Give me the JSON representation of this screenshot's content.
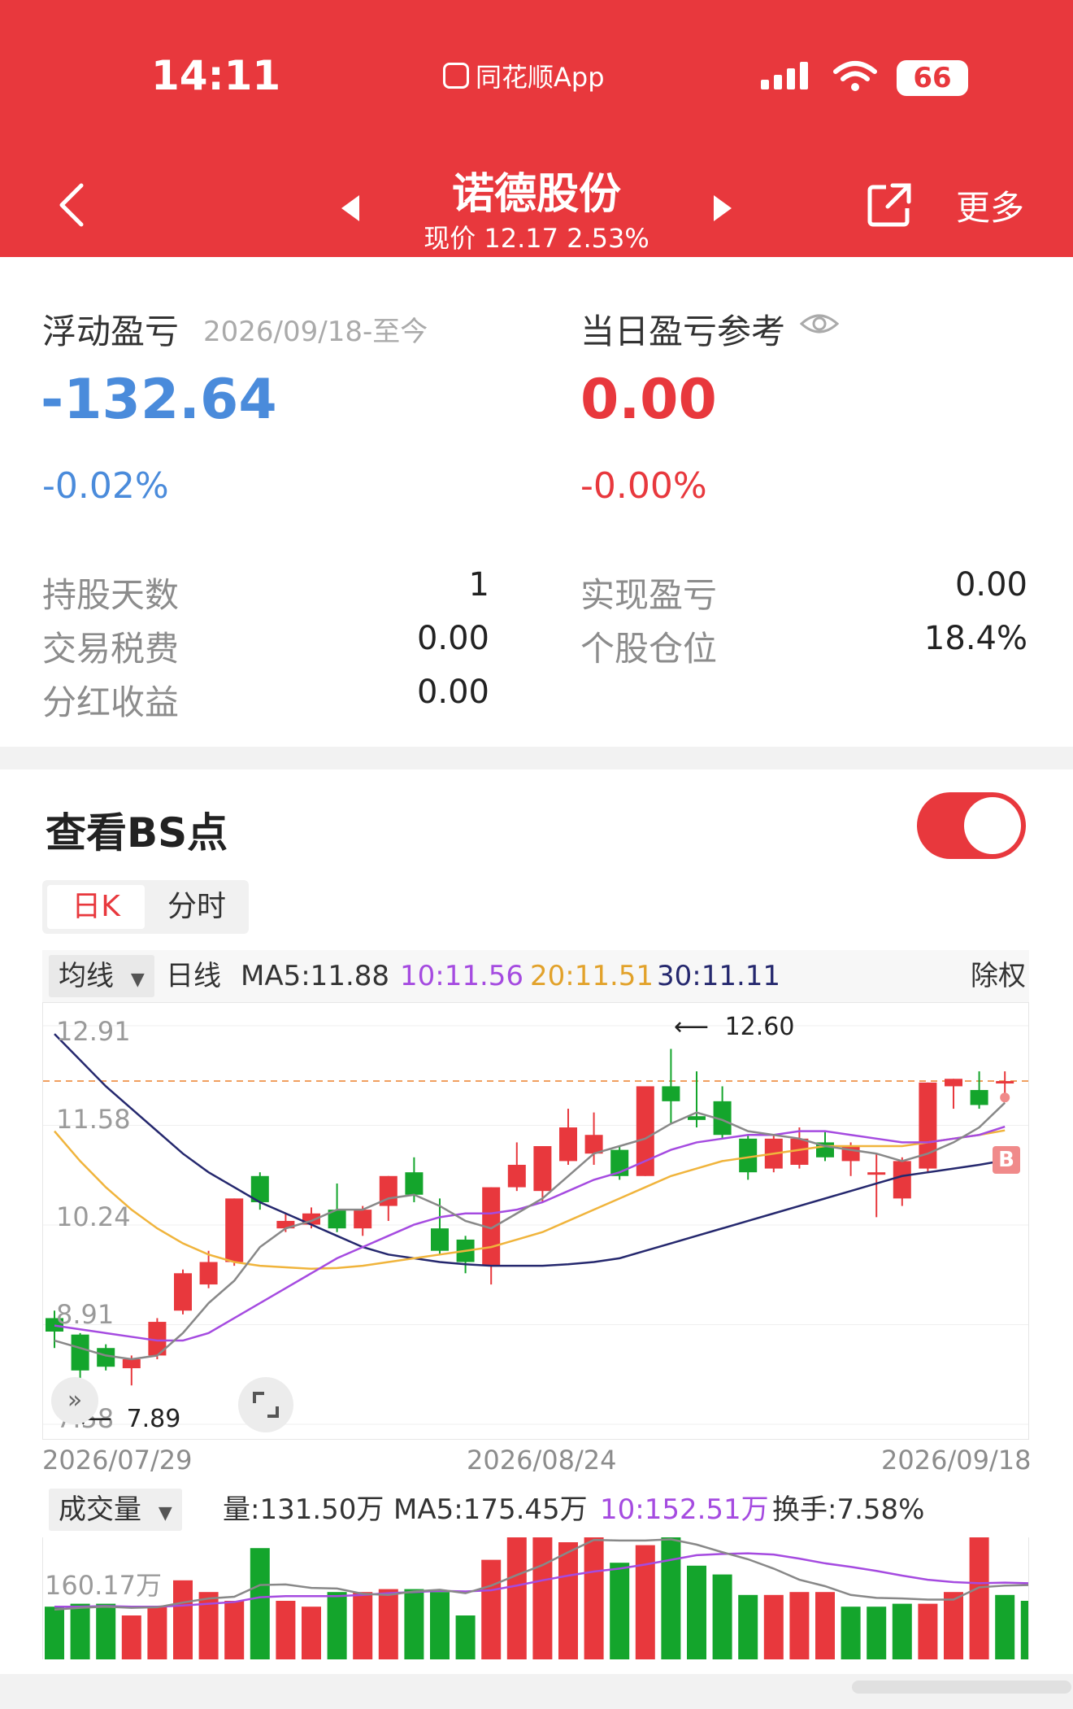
{
  "status_bar": {
    "time": "14:11",
    "app_label": "同花顺App",
    "battery": "66"
  },
  "nav": {
    "title": "诺德股份",
    "subtitle": "现价 12.17 2.53%",
    "more_label": "更多"
  },
  "pnl": {
    "float_label": "浮动盈亏",
    "float_range": "2026/09/18-至今",
    "float_value": "-132.64",
    "float_pct": "-0.02%",
    "day_label": "当日盈亏参考",
    "day_value": "0.00",
    "day_pct": "-0.00%"
  },
  "stats": [
    {
      "label": "持股天数",
      "value": "1"
    },
    {
      "label": "交易税费",
      "value": "0.00"
    },
    {
      "label": "分红收益",
      "value": "0.00"
    },
    {
      "label": "实现盈亏",
      "value": "0.00"
    },
    {
      "label": "个股仓位",
      "value": "18.4%"
    }
  ],
  "bs": {
    "title": "查看BS点",
    "toggle_on": true
  },
  "tabs": {
    "day_k": "日K",
    "intraday": "分时"
  },
  "kline": {
    "ma_dropdown": "均线",
    "period": "日线",
    "ma5": "MA5:11.88",
    "ma10": "10:11.56",
    "ma20": "20:11.51",
    "ma30": "30:11.11",
    "adjust": "除权",
    "y_labels": [
      "12.91",
      "11.58",
      "10.24",
      "8.91",
      "7.58"
    ],
    "x_labels": [
      "2026/07/29",
      "2026/08/24",
      "2026/09/18"
    ],
    "high_note": "12.60",
    "low_note": "7.89",
    "buy_marker": "B",
    "colors": {
      "up": "#e8383d",
      "down": "#14a52c",
      "ma5": "#888888",
      "ma10": "#a54be0",
      "ma20": "#f0b43c",
      "ma30": "#25286e"
    }
  },
  "volume": {
    "dropdown": "成交量",
    "vol": "量:131.50万",
    "ma5": "MA5:175.45万",
    "ma10": "10:152.51万",
    "turnover": "换手:7.58%",
    "y_label": "160.17万"
  },
  "chart_data": {
    "type": "candlestick",
    "x_start": "2026/07/29",
    "x_mid": "2026/08/24",
    "x_end": "2026/09/18",
    "ylim": [
      7.58,
      12.91
    ],
    "candles": [
      {
        "o": 9.0,
        "c": 8.82,
        "h": 9.1,
        "l": 8.6
      },
      {
        "o": 8.78,
        "c": 8.3,
        "h": 8.8,
        "l": 7.95
      },
      {
        "o": 8.6,
        "c": 8.35,
        "h": 8.65,
        "l": 8.3
      },
      {
        "o": 8.33,
        "c": 8.45,
        "h": 8.5,
        "l": 8.1
      },
      {
        "o": 8.5,
        "c": 8.95,
        "h": 9.0,
        "l": 8.45
      },
      {
        "o": 9.1,
        "c": 9.6,
        "h": 9.65,
        "l": 9.05
      },
      {
        "o": 9.45,
        "c": 9.75,
        "h": 9.9,
        "l": 9.4
      },
      {
        "o": 9.75,
        "c": 10.6,
        "h": 10.6,
        "l": 9.7
      },
      {
        "o": 10.9,
        "c": 10.55,
        "h": 10.95,
        "l": 10.45
      },
      {
        "o": 10.2,
        "c": 10.3,
        "h": 10.4,
        "l": 10.15
      },
      {
        "o": 10.25,
        "c": 10.4,
        "h": 10.48,
        "l": 10.2
      },
      {
        "o": 10.45,
        "c": 10.2,
        "h": 10.8,
        "l": 10.15
      },
      {
        "o": 10.2,
        "c": 10.45,
        "h": 10.5,
        "l": 10.1
      },
      {
        "o": 10.5,
        "c": 10.9,
        "h": 10.9,
        "l": 10.3
      },
      {
        "o": 10.95,
        "c": 10.65,
        "h": 11.15,
        "l": 10.55
      },
      {
        "o": 10.2,
        "c": 9.9,
        "h": 10.6,
        "l": 9.85
      },
      {
        "o": 10.05,
        "c": 9.75,
        "h": 10.1,
        "l": 9.6
      },
      {
        "o": 9.7,
        "c": 10.75,
        "h": 10.75,
        "l": 9.45
      },
      {
        "o": 10.75,
        "c": 11.05,
        "h": 11.35,
        "l": 10.7
      },
      {
        "o": 10.7,
        "c": 11.3,
        "h": 11.3,
        "l": 10.55
      },
      {
        "o": 11.1,
        "c": 11.55,
        "h": 11.8,
        "l": 11.05
      },
      {
        "o": 11.2,
        "c": 11.45,
        "h": 11.75,
        "l": 11.05
      },
      {
        "o": 11.25,
        "c": 10.9,
        "h": 11.3,
        "l": 10.85
      },
      {
        "o": 10.9,
        "c": 12.1,
        "h": 12.1,
        "l": 10.9
      },
      {
        "o": 12.1,
        "c": 11.9,
        "h": 12.6,
        "l": 11.6
      },
      {
        "o": 11.7,
        "c": 11.65,
        "h": 12.3,
        "l": 11.55
      },
      {
        "o": 11.9,
        "c": 11.45,
        "h": 12.1,
        "l": 11.4
      },
      {
        "o": 11.4,
        "c": 10.95,
        "h": 11.45,
        "l": 10.85
      },
      {
        "o": 11.0,
        "c": 11.4,
        "h": 11.45,
        "l": 10.95
      },
      {
        "o": 11.05,
        "c": 11.4,
        "h": 11.55,
        "l": 11.0
      },
      {
        "o": 11.35,
        "c": 11.15,
        "h": 11.5,
        "l": 11.1
      },
      {
        "o": 11.1,
        "c": 11.3,
        "h": 11.35,
        "l": 10.9
      },
      {
        "o": 10.95,
        "c": 10.95,
        "h": 11.2,
        "l": 10.35
      },
      {
        "o": 10.6,
        "c": 11.1,
        "h": 11.15,
        "l": 10.5
      },
      {
        "o": 11.0,
        "c": 12.15,
        "h": 12.15,
        "l": 10.95
      },
      {
        "o": 12.1,
        "c": 12.2,
        "h": 12.2,
        "l": 11.8
      },
      {
        "o": 12.05,
        "c": 11.85,
        "h": 12.3,
        "l": 11.8
      },
      {
        "o": 12.15,
        "c": 12.17,
        "h": 12.3,
        "l": 11.95
      }
    ],
    "ma5": [
      8.7,
      8.6,
      8.5,
      8.45,
      8.5,
      8.8,
      9.2,
      9.5,
      9.95,
      10.2,
      10.3,
      10.45,
      10.45,
      10.6,
      10.65,
      10.5,
      10.3,
      10.2,
      10.4,
      10.6,
      10.9,
      11.2,
      11.3,
      11.4,
      11.6,
      11.75,
      11.65,
      11.5,
      11.45,
      11.4,
      11.3,
      11.25,
      11.2,
      11.1,
      11.2,
      11.35,
      11.55,
      11.88
    ],
    "ma10": [
      8.9,
      8.85,
      8.8,
      8.75,
      8.7,
      8.7,
      8.8,
      9.0,
      9.2,
      9.4,
      9.6,
      9.8,
      9.95,
      10.1,
      10.25,
      10.35,
      10.4,
      10.4,
      10.45,
      10.55,
      10.7,
      10.85,
      10.95,
      11.1,
      11.25,
      11.35,
      11.4,
      11.45,
      11.45,
      11.5,
      11.5,
      11.45,
      11.4,
      11.35,
      11.35,
      11.4,
      11.45,
      11.56
    ],
    "ma20": [
      11.5,
      11.1,
      10.75,
      10.45,
      10.2,
      10.0,
      9.85,
      9.75,
      9.7,
      9.68,
      9.66,
      9.67,
      9.7,
      9.75,
      9.8,
      9.85,
      9.9,
      9.95,
      10.05,
      10.15,
      10.3,
      10.45,
      10.6,
      10.75,
      10.9,
      11.0,
      11.1,
      11.15,
      11.2,
      11.25,
      11.3,
      11.3,
      11.3,
      11.3,
      11.35,
      11.4,
      11.45,
      11.51
    ],
    "ma30": [
      12.8,
      12.45,
      12.1,
      11.8,
      11.5,
      11.2,
      10.95,
      10.75,
      10.55,
      10.4,
      10.25,
      10.1,
      9.95,
      9.85,
      9.8,
      9.75,
      9.72,
      9.7,
      9.7,
      9.7,
      9.72,
      9.75,
      9.8,
      9.9,
      10.0,
      10.1,
      10.2,
      10.3,
      10.4,
      10.5,
      10.6,
      10.7,
      10.8,
      10.9,
      10.95,
      11.0,
      11.05,
      11.11
    ],
    "volume": {
      "unit": "万",
      "ylim": [
        0,
        200
      ],
      "values": [
        90,
        95,
        95,
        75,
        90,
        135,
        115,
        100,
        190,
        100,
        90,
        115,
        115,
        120,
        120,
        115,
        75,
        170,
        230,
        210,
        200,
        210,
        165,
        195,
        245,
        160,
        145,
        110,
        110,
        115,
        115,
        90,
        90,
        95,
        95,
        115,
        220,
        110,
        100
      ],
      "up": [
        false,
        false,
        false,
        true,
        true,
        true,
        true,
        true,
        false,
        true,
        true,
        false,
        true,
        true,
        false,
        false,
        false,
        true,
        true,
        true,
        true,
        true,
        false,
        true,
        false,
        false,
        false,
        false,
        true,
        true,
        true,
        false,
        false,
        false,
        true,
        true,
        true,
        false,
        false
      ],
      "ma5": [
        85,
        88,
        90,
        88,
        89,
        97,
        104,
        107,
        127,
        128,
        122,
        121,
        112,
        110,
        116,
        119,
        113,
        126,
        144,
        161,
        183,
        204,
        203,
        203,
        205,
        196,
        183,
        171,
        155,
        136,
        125,
        110,
        105,
        104,
        102,
        102,
        123,
        126,
        127
      ],
      "ma10": [
        90,
        90,
        91,
        90,
        90,
        92,
        95,
        98,
        106,
        108,
        108,
        108,
        110,
        113,
        115,
        117,
        116,
        118,
        126,
        135,
        143,
        150,
        155,
        162,
        170,
        178,
        180,
        181,
        179,
        172,
        164,
        158,
        151,
        143,
        136,
        132,
        130,
        131,
        130
      ]
    }
  }
}
